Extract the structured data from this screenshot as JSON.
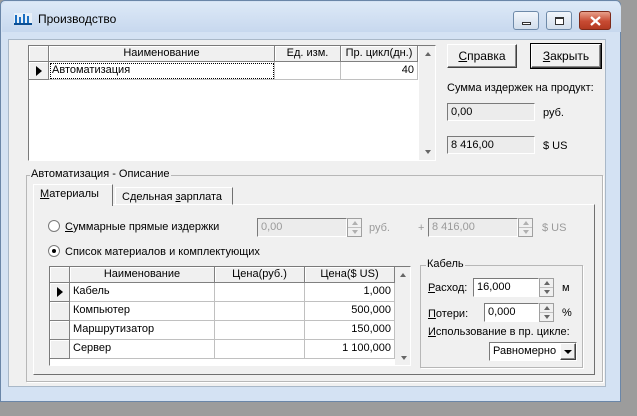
{
  "window": {
    "title": "Производство",
    "controls": [
      "minimize-icon",
      "maximize-icon",
      "close-icon"
    ]
  },
  "top_grid": {
    "columns": [
      "Наименование",
      "Ед. изм.",
      "Пр. цикл(дн.)"
    ],
    "rows": [
      {
        "name": "Автоматизация",
        "unit": "",
        "cycle": "40",
        "current": true
      }
    ]
  },
  "buttons": {
    "help": "Справка",
    "help_mnemonic": "С",
    "close": "Закрыть",
    "close_mnemonic": "З"
  },
  "cost_summary": {
    "label": "Сумма издержек на продукт:",
    "rub_value": "0,00",
    "rub_unit": "руб.",
    "usd_value": "8 416,00",
    "usd_unit": "$ US"
  },
  "description_group": {
    "title": "Автоматизация - Описание",
    "tabs": [
      {
        "label": "Материалы",
        "mnemonic_index": 0,
        "active": true
      },
      {
        "label": "Сдельная зарплата",
        "mnemonic_index": 9,
        "active": false
      }
    ]
  },
  "materials_tab": {
    "radio_total": {
      "label": "Суммарные прямые издержки",
      "checked": false,
      "rub_value": "0,00",
      "rub_unit": "руб.",
      "plus": "+",
      "usd_value": "8 416,00",
      "usd_unit": "$ US"
    },
    "radio_list": {
      "label": "Список материалов и комплектующих",
      "checked": true
    },
    "grid": {
      "columns": [
        "Наименование",
        "Цена(руб.)",
        "Цена($ US)"
      ],
      "rows": [
        {
          "name": "Кабель",
          "price_rub": "",
          "price_usd": "1,000",
          "current": true
        },
        {
          "name": "Компьютер",
          "price_rub": "",
          "price_usd": "500,000",
          "current": false
        },
        {
          "name": "Маршрутизатор",
          "price_rub": "",
          "price_usd": "150,000",
          "current": false
        },
        {
          "name": "Сервер",
          "price_rub": "",
          "price_usd": "1 100,000",
          "current": false
        }
      ]
    },
    "item_group": {
      "title": "Кабель",
      "consumption_label": "Расход:",
      "consumption_value": "16,000",
      "consumption_unit": "м",
      "losses_label": "Потери:",
      "losses_value": "0,000",
      "losses_unit": "%",
      "usage_label": "Использование в пр. цикле:",
      "usage_value": "Равномерно"
    }
  }
}
